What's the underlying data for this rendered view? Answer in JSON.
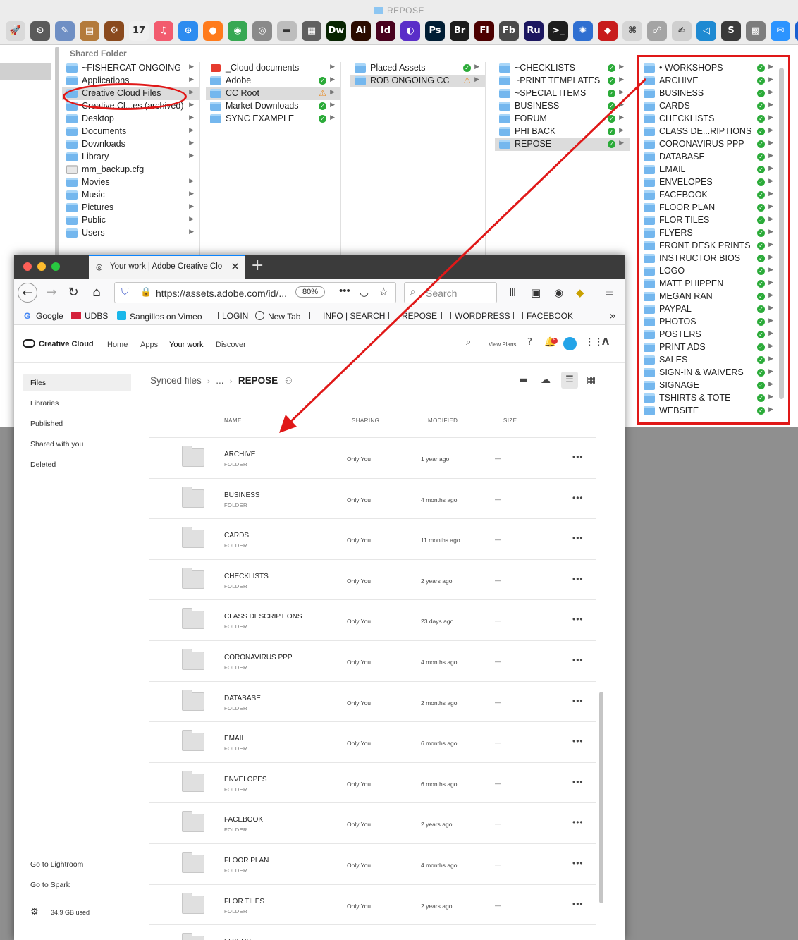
{
  "finder": {
    "window_title": "REPOSE",
    "path_label": "Shared Folder",
    "toolbar_apps": [
      {
        "icon": "rocket-icon",
        "glyph": "🚀",
        "bg": "#d9d9d9"
      },
      {
        "icon": "clock-icon",
        "glyph": "⏲",
        "bg": "#5a5a5a"
      },
      {
        "icon": "preview-icon",
        "glyph": "✎",
        "bg": "#6f8fc4"
      },
      {
        "icon": "notebook-icon",
        "glyph": "▤",
        "bg": "#b37a3b"
      },
      {
        "icon": "cannon-icon",
        "glyph": "⚙",
        "bg": "#8a4a1e"
      },
      {
        "icon": "calendar-icon",
        "glyph": "17",
        "bg": "#f0f0f0"
      },
      {
        "icon": "music-icon",
        "glyph": "♫",
        "bg": "#f25b6e"
      },
      {
        "icon": "safari-icon",
        "glyph": "⊕",
        "bg": "#2d8cf0"
      },
      {
        "icon": "firefox-icon",
        "glyph": "●",
        "bg": "#ff7b1c"
      },
      {
        "icon": "chrome-icon",
        "glyph": "◉",
        "bg": "#37a853"
      },
      {
        "icon": "disk-icon",
        "glyph": "◎",
        "bg": "#8a8a8a"
      },
      {
        "icon": "scanner-icon",
        "glyph": "▬",
        "bg": "#bdbdbd"
      },
      {
        "icon": "printer-icon",
        "glyph": "▦",
        "bg": "#606060"
      },
      {
        "icon": "dreamweaver-icon",
        "glyph": "Dw",
        "bg": "#072401"
      },
      {
        "icon": "illustrator-icon",
        "glyph": "Ai",
        "bg": "#2b0c00"
      },
      {
        "icon": "indesign-icon",
        "glyph": "Id",
        "bg": "#49021f"
      },
      {
        "icon": "cloud-app-icon",
        "glyph": "◐",
        "bg": "#5a2ec8"
      },
      {
        "icon": "photoshop-icon",
        "glyph": "Ps",
        "bg": "#001d34"
      },
      {
        "icon": "bridge-icon",
        "glyph": "Br",
        "bg": "#1b1b1b"
      },
      {
        "icon": "flash-icon",
        "glyph": "Fl",
        "bg": "#4c0000"
      },
      {
        "icon": "flashbuilder-icon",
        "glyph": "Fb",
        "bg": "#4a4a4a"
      },
      {
        "icon": "robohelp-icon",
        "glyph": "Ru",
        "bg": "#1c1760"
      },
      {
        "icon": "terminal-icon",
        "glyph": ">_",
        "bg": "#1e1e1e"
      },
      {
        "icon": "beachball-icon",
        "glyph": "✺",
        "bg": "#2f6fd1"
      },
      {
        "icon": "ruby-icon",
        "glyph": "◆",
        "bg": "#c81d1d"
      },
      {
        "icon": "keyboard-icon",
        "glyph": "⌘",
        "bg": "#d5d5d5"
      },
      {
        "icon": "utility-icon",
        "glyph": "☍",
        "bg": "#a4a4a4"
      },
      {
        "icon": "scriptedit-icon",
        "glyph": "✍",
        "bg": "#cfcfcf"
      },
      {
        "icon": "vscode-icon",
        "glyph": "◁",
        "bg": "#1f8ad2"
      },
      {
        "icon": "sublime-icon",
        "glyph": "S",
        "bg": "#3a3a3a"
      },
      {
        "icon": "calculator-icon",
        "glyph": "▩",
        "bg": "#7d7d7d"
      },
      {
        "icon": "messages-icon",
        "glyph": "✉",
        "bg": "#2c94ff"
      },
      {
        "icon": "extra-icon",
        "glyph": "◗",
        "bg": "#1a5fd0"
      }
    ],
    "col1": [
      {
        "label": "~FISHERCAT ONGOING",
        "icon": "folder",
        "chev": true
      },
      {
        "label": "Applications",
        "icon": "folder",
        "chev": true
      },
      {
        "label": "Creative Cloud Files",
        "icon": "folder",
        "chev": true,
        "sel": true
      },
      {
        "label": "Creative Cl...es (archived)",
        "icon": "folder",
        "chev": true
      },
      {
        "label": "Desktop",
        "icon": "folder",
        "chev": true
      },
      {
        "label": "Documents",
        "icon": "folder",
        "chev": true
      },
      {
        "label": "Downloads",
        "icon": "folder",
        "chev": true
      },
      {
        "label": "Library",
        "icon": "folder",
        "chev": true
      },
      {
        "label": "mm_backup.cfg",
        "icon": "doc",
        "chev": false
      },
      {
        "label": "Movies",
        "icon": "folder",
        "chev": true
      },
      {
        "label": "Music",
        "icon": "folder",
        "chev": true
      },
      {
        "label": "Pictures",
        "icon": "folder",
        "chev": true
      },
      {
        "label": "Public",
        "icon": "folder",
        "chev": true
      },
      {
        "label": "Users",
        "icon": "folder",
        "chev": true
      }
    ],
    "col2": [
      {
        "label": "_Cloud documents",
        "icon": "cc",
        "status": "",
        "chev": true
      },
      {
        "label": "Adobe",
        "icon": "folder",
        "status": "ok",
        "chev": true
      },
      {
        "label": "CC Root",
        "icon": "folder",
        "status": "warn",
        "chev": true,
        "sel": true
      },
      {
        "label": "Market Downloads",
        "icon": "folder",
        "status": "ok",
        "chev": true
      },
      {
        "label": "SYNC EXAMPLE",
        "icon": "folder",
        "status": "ok",
        "chev": true
      }
    ],
    "col3": [
      {
        "label": "Placed Assets",
        "icon": "folder",
        "status": "ok",
        "chev": true
      },
      {
        "label": "ROB ONGOING CC",
        "icon": "folder",
        "status": "warn",
        "chev": true,
        "sel": true
      }
    ],
    "col4": [
      {
        "label": "~CHECKLISTS",
        "icon": "folder",
        "status": "ok",
        "chev": true
      },
      {
        "label": "~PRINT TEMPLATES",
        "icon": "folder",
        "status": "ok",
        "chev": true
      },
      {
        "label": "~SPECIAL ITEMS",
        "icon": "folder",
        "status": "ok",
        "chev": true
      },
      {
        "label": "BUSINESS",
        "icon": "folder",
        "status": "ok",
        "chev": true
      },
      {
        "label": "FORUM",
        "icon": "folder",
        "status": "ok",
        "chev": true
      },
      {
        "label": "PHI BACK",
        "icon": "folder",
        "status": "ok",
        "chev": true
      },
      {
        "label": "REPOSE",
        "icon": "folder",
        "status": "ok",
        "chev": true,
        "sel": true
      }
    ],
    "col5": [
      {
        "label": "• WORKSHOPS",
        "icon": "folder",
        "status": "ok",
        "chev": true
      },
      {
        "label": "ARCHIVE",
        "icon": "folder",
        "status": "ok",
        "chev": true
      },
      {
        "label": "BUSINESS",
        "icon": "folder",
        "status": "ok",
        "chev": true
      },
      {
        "label": "CARDS",
        "icon": "folder",
        "status": "ok",
        "chev": true
      },
      {
        "label": "CHECKLISTS",
        "icon": "folder",
        "status": "ok",
        "chev": true
      },
      {
        "label": "CLASS DE...RIPTIONS",
        "icon": "folder",
        "status": "ok",
        "chev": true
      },
      {
        "label": "CORONAVIRUS PPP",
        "icon": "folder",
        "status": "ok",
        "chev": true
      },
      {
        "label": "DATABASE",
        "icon": "folder",
        "status": "ok",
        "chev": true
      },
      {
        "label": "EMAIL",
        "icon": "folder",
        "status": "ok",
        "chev": true
      },
      {
        "label": "ENVELOPES",
        "icon": "folder",
        "status": "ok",
        "chev": true
      },
      {
        "label": "FACEBOOK",
        "icon": "folder",
        "status": "ok",
        "chev": true
      },
      {
        "label": "FLOOR PLAN",
        "icon": "folder",
        "status": "ok",
        "chev": true
      },
      {
        "label": "FLOR TILES",
        "icon": "folder",
        "status": "ok",
        "chev": true
      },
      {
        "label": "FLYERS",
        "icon": "folder",
        "status": "ok",
        "chev": true
      },
      {
        "label": "FRONT DESK PRINTS",
        "icon": "folder",
        "status": "ok",
        "chev": true
      },
      {
        "label": "INSTRUCTOR BIOS",
        "icon": "folder",
        "status": "ok",
        "chev": true
      },
      {
        "label": "LOGO",
        "icon": "folder",
        "status": "ok",
        "chev": true
      },
      {
        "label": "MATT PHIPPEN",
        "icon": "folder",
        "status": "ok",
        "chev": true
      },
      {
        "label": "MEGAN RAN",
        "icon": "folder",
        "status": "ok",
        "chev": true
      },
      {
        "label": "PAYPAL",
        "icon": "folder",
        "status": "ok",
        "chev": true
      },
      {
        "label": "PHOTOS",
        "icon": "folder",
        "status": "ok",
        "chev": true
      },
      {
        "label": "POSTERS",
        "icon": "folder",
        "status": "ok",
        "chev": true
      },
      {
        "label": "PRINT ADS",
        "icon": "folder",
        "status": "ok",
        "chev": true
      },
      {
        "label": "SALES",
        "icon": "folder",
        "status": "ok",
        "chev": true
      },
      {
        "label": "SIGN-IN & WAIVERS",
        "icon": "folder",
        "status": "ok",
        "chev": true
      },
      {
        "label": "SIGNAGE",
        "icon": "folder",
        "status": "ok",
        "chev": true
      },
      {
        "label": "TSHIRTS & TOTE",
        "icon": "folder",
        "status": "ok",
        "chev": true
      },
      {
        "label": "WEBSITE",
        "icon": "folder",
        "status": "ok",
        "chev": true
      }
    ]
  },
  "annotation_color": "#e01818",
  "browser": {
    "tab_title": "Your work | Adobe Creative Clo",
    "new_tab": "+",
    "url": "https://assets.adobe.com/id/...",
    "zoom": "80%",
    "more_dots": "•••",
    "search_placeholder": "Search",
    "bookmarks": [
      {
        "label": "Google",
        "icon": "g"
      },
      {
        "label": "UDBS",
        "icon": "u"
      },
      {
        "label": "Sangillos on Vimeo",
        "icon": "v"
      },
      {
        "label": "LOGIN",
        "icon": "folder"
      },
      {
        "label": "New Tab",
        "icon": "globe"
      },
      {
        "label": "INFO | SEARCH",
        "icon": "folder"
      },
      {
        "label": "REPOSE",
        "icon": "folder"
      },
      {
        "label": "WORDPRESS",
        "icon": "folder"
      },
      {
        "label": "FACEBOOK",
        "icon": "folder"
      }
    ],
    "overflow": "»"
  },
  "cc": {
    "logo": "Creative Cloud",
    "nav": [
      "Home",
      "Apps",
      "Your work",
      "Discover"
    ],
    "view_plans": "View Plans",
    "notif_count": "5",
    "sidebar": [
      "Files",
      "Libraries",
      "Published",
      "Shared with you",
      "Deleted"
    ],
    "go_lightroom": "Go to Lightroom",
    "go_spark": "Go to Spark",
    "storage": "34.9 GB used",
    "breadcrumb": {
      "root": "Synced files",
      "ellipsis": "...",
      "current": "REPOSE"
    },
    "columns": {
      "name": "NAME",
      "sort": "↑",
      "sharing": "SHARING",
      "modified": "MODIFIED",
      "size": "SIZE"
    },
    "rows": [
      {
        "name": "ARCHIVE",
        "kind": "FOLDER",
        "sharing": "Only You",
        "modified": "1 year ago",
        "size": "—",
        "more": "•••"
      },
      {
        "name": "BUSINESS",
        "kind": "FOLDER",
        "sharing": "Only You",
        "modified": "4 months ago",
        "size": "—",
        "more": "•••"
      },
      {
        "name": "CARDS",
        "kind": "FOLDER",
        "sharing": "Only You",
        "modified": "11 months ago",
        "size": "—",
        "more": "•••"
      },
      {
        "name": "CHECKLISTS",
        "kind": "FOLDER",
        "sharing": "Only You",
        "modified": "2 years ago",
        "size": "—",
        "more": "•••"
      },
      {
        "name": "CLASS DESCRIPTIONS",
        "kind": "FOLDER",
        "sharing": "Only You",
        "modified": "23 days ago",
        "size": "—",
        "more": "•••"
      },
      {
        "name": "CORONAVIRUS PPP",
        "kind": "FOLDER",
        "sharing": "Only You",
        "modified": "4 months ago",
        "size": "—",
        "more": "•••"
      },
      {
        "name": "DATABASE",
        "kind": "FOLDER",
        "sharing": "Only You",
        "modified": "2 months ago",
        "size": "—",
        "more": "•••"
      },
      {
        "name": "EMAIL",
        "kind": "FOLDER",
        "sharing": "Only You",
        "modified": "6 months ago",
        "size": "—",
        "more": "•••"
      },
      {
        "name": "ENVELOPES",
        "kind": "FOLDER",
        "sharing": "Only You",
        "modified": "6 months ago",
        "size": "—",
        "more": "•••"
      },
      {
        "name": "FACEBOOK",
        "kind": "FOLDER",
        "sharing": "Only You",
        "modified": "2 years ago",
        "size": "—",
        "more": "•••"
      },
      {
        "name": "FLOOR PLAN",
        "kind": "FOLDER",
        "sharing": "Only You",
        "modified": "4 months ago",
        "size": "—",
        "more": "•••"
      },
      {
        "name": "FLOR TILES",
        "kind": "FOLDER",
        "sharing": "Only You",
        "modified": "2 years ago",
        "size": "—",
        "more": "•••"
      },
      {
        "name": "FLYERS",
        "kind": "",
        "sharing": "",
        "modified": "",
        "size": "",
        "more": ""
      }
    ]
  }
}
